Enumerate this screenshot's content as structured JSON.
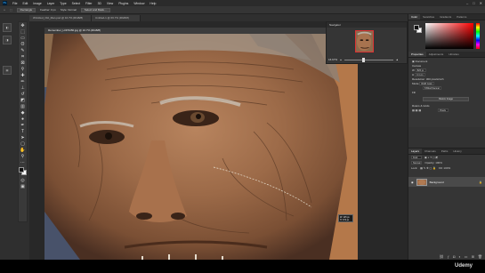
{
  "app": {
    "logo": "Ps",
    "menu": [
      "File",
      "Edit",
      "Image",
      "Layer",
      "Type",
      "Select",
      "Filter",
      "3D",
      "View",
      "Plugins",
      "Window",
      "Help"
    ]
  },
  "options_bar": {
    "mode": "Rectangle",
    "feather": "Feather: 0 px",
    "style": "Style: Normal",
    "select_mask": "Select and Mask..."
  },
  "document_tabs": [
    {
      "label": "Wrinkled_Old_Man.psd @ 16.7% (RGB/8)",
      "active": false
    },
    {
      "label": "Untitled-1 @ 66.7% (RGB/8)",
      "active": false
    }
  ],
  "document": {
    "title": "Remember_LOP3450.jpg @ 16.7% (RGB/8)",
    "info_w": "W: 425 px",
    "info_h": "H: 372 px"
  },
  "navigator": {
    "title": "Navigator",
    "zoom": "16.67%"
  },
  "right_panel": {
    "color_tabs": [
      "Color",
      "Swatches",
      "Gradients",
      "Patterns"
    ],
    "props_tabs": [
      "Properties",
      "Adjustments",
      "Libraries"
    ],
    "doc_type": "Document",
    "canvas_label": "Canvas",
    "w_label": "W",
    "w_value": "826 px",
    "h_label": "H",
    "h_value": "0.4 cm",
    "resolution": "Resolution: 300 pixels/inch",
    "mode_label": "Mode",
    "mode_value": "RGB Color",
    "depth_value": "8 Bits/Channel",
    "fill_label": "Fill",
    "resize_btn": "Resize Image",
    "rulers_label": "Rulers & Grids",
    "grid_value": "Pixels"
  },
  "layers": {
    "tabs": [
      "Layers",
      "Channels",
      "Paths",
      "History"
    ],
    "kind_label": "Kind",
    "blend_mode": "Normal",
    "opacity_label": "Opacity: 100%",
    "lock_label": "Lock:",
    "fill_label": "Fill: 100%",
    "layer_name": "Background"
  },
  "status": {
    "watermark": "Udemy"
  }
}
